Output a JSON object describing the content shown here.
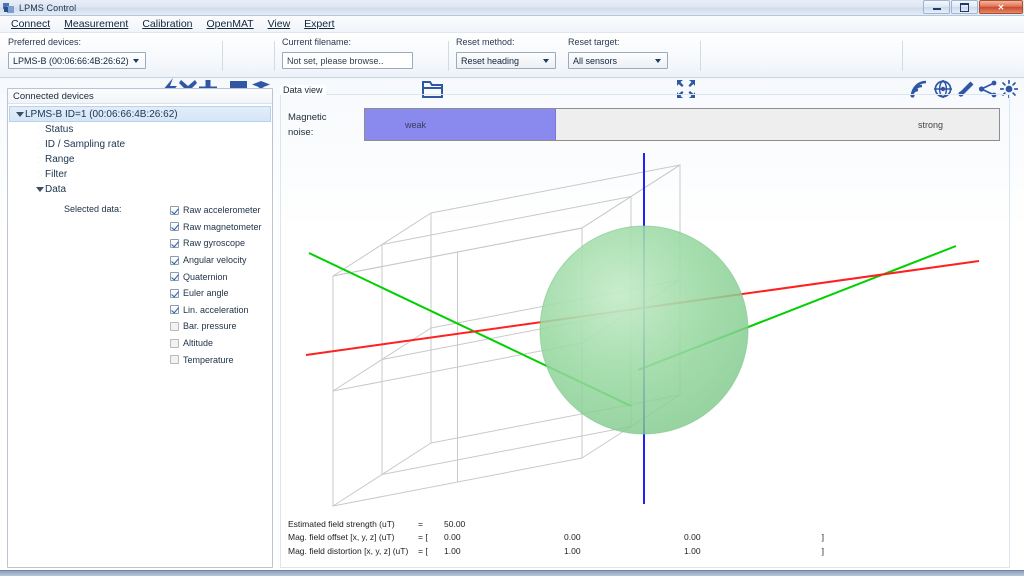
{
  "window": {
    "title": "LPMS Control",
    "icon": "app-icon",
    "buttons": {
      "minimize": "–",
      "restore": "❐",
      "close": "✕"
    }
  },
  "menu": {
    "items": [
      {
        "label": "Connect",
        "mnemonic": "C"
      },
      {
        "label": "Measurement",
        "mnemonic": "M"
      },
      {
        "label": "Calibration",
        "mnemonic": "C"
      },
      {
        "label": "OpenMAT",
        "mnemonic": "O"
      },
      {
        "label": "View",
        "mnemonic": "V"
      },
      {
        "label": "Expert",
        "mnemonic": "E"
      }
    ]
  },
  "toolbar": {
    "preferred_devices_label": "Preferred devices:",
    "preferred_devices_value": "LPMS-B (00:06:66:4B:26:62)",
    "current_filename_label": "Current filename:",
    "current_filename_value": "Not set, please browse..",
    "reset_method_label": "Reset method:",
    "reset_method_value": "Reset heading",
    "reset_target_label": "Reset target:",
    "reset_target_value": "All sensors",
    "icons": {
      "connect": "lightning-icon",
      "disconnect": "x-icon",
      "add": "plus-icon",
      "stop": "stop-square-icon",
      "layers": "layers-icon",
      "browse": "folder-icon",
      "fit": "collapse-arrows-icon",
      "signal": "signal-icon",
      "globe": "globe-icon",
      "magnet": "magnet-icon",
      "share": "share-nodes-icon",
      "brightness": "brightness-icon"
    }
  },
  "sidebar": {
    "header": "Connected devices",
    "root": {
      "label": "LPMS-B ID=1 (00:06:66:4B:26:62)",
      "expanded": true,
      "selected": true
    },
    "nodes": [
      {
        "label": "Status",
        "expanded": false
      },
      {
        "label": "ID / Sampling rate",
        "expanded": false
      },
      {
        "label": "Range",
        "expanded": false
      },
      {
        "label": "Filter",
        "expanded": false
      },
      {
        "label": "Data",
        "expanded": true
      }
    ],
    "selected_data_label": "Selected data:",
    "checkboxes": [
      {
        "label": "Raw accelerometer",
        "checked": true
      },
      {
        "label": "Raw magnetometer",
        "checked": true
      },
      {
        "label": "Raw gyroscope",
        "checked": true
      },
      {
        "label": "Angular velocity",
        "checked": true
      },
      {
        "label": "Quaternion",
        "checked": true
      },
      {
        "label": "Euler angle",
        "checked": true
      },
      {
        "label": "Lin. acceleration",
        "checked": true
      },
      {
        "label": "Bar. pressure",
        "checked": false
      },
      {
        "label": "Altitude",
        "checked": false
      },
      {
        "label": "Temperature",
        "checked": false
      }
    ]
  },
  "dataview": {
    "legend": "Data view",
    "magnetic_noise_label_line1": "Magnetic",
    "magnetic_noise_label_line2": "noise:",
    "bar": {
      "weak_label": "weak",
      "strong_label": "strong",
      "fill_percent": 30,
      "fill_color": "#8a8aee",
      "track_color": "#eeeeee"
    },
    "viewport": {
      "axis_x_color": "#ff2020",
      "axis_y_color": "#00d000",
      "axis_z_color": "#2020ff",
      "sphere_color": "#8fd79a",
      "grid_color": "#c9c9c9"
    },
    "readouts": [
      {
        "name": "Estimated field strength (uT)",
        "eq": "=",
        "open": "",
        "v1": "50.00",
        "v2": "",
        "v3": "",
        "close": ""
      },
      {
        "name": "Mag. field offset [x, y, z] (uT)",
        "eq": "= [",
        "open": "",
        "v1": "0.00",
        "v2": "0.00",
        "v3": "0.00",
        "close": "]"
      },
      {
        "name": "Mag. field distortion [x, y, z] (uT)",
        "eq": "= [",
        "open": "",
        "v1": "1.00",
        "v2": "1.00",
        "v3": "1.00",
        "close": "]"
      }
    ]
  }
}
